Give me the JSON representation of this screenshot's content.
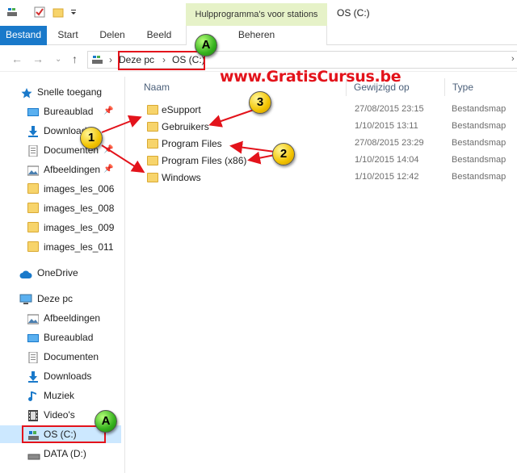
{
  "window": {
    "title": "OS (C:)",
    "context_tab": "Hulpprogramma's voor stations"
  },
  "ribbon": {
    "tabs": [
      "Bestand",
      "Start",
      "Delen",
      "Beeld",
      "Beheren"
    ]
  },
  "address": {
    "crumbs": [
      "Deze pc",
      "OS (C:)"
    ]
  },
  "watermark": "www.GratisCursus.be",
  "sidebar": {
    "quick_access": "Snelle toegang",
    "quick_items": [
      {
        "label": "Bureaublad",
        "icon": "desktop-icon"
      },
      {
        "label": "Downloads",
        "icon": "download-icon"
      },
      {
        "label": "Documenten",
        "icon": "document-icon"
      },
      {
        "label": "Afbeeldingen",
        "icon": "picture-icon"
      },
      {
        "label": "images_les_006",
        "icon": "folder-icon"
      },
      {
        "label": "images_les_008",
        "icon": "folder-icon"
      },
      {
        "label": "images_les_009",
        "icon": "folder-icon"
      },
      {
        "label": "images_les_011",
        "icon": "folder-icon"
      }
    ],
    "onedrive": "OneDrive",
    "this_pc": "Deze pc",
    "pc_items": [
      {
        "label": "Afbeeldingen",
        "icon": "picture-icon"
      },
      {
        "label": "Bureaublad",
        "icon": "desktop-icon"
      },
      {
        "label": "Documenten",
        "icon": "document-icon"
      },
      {
        "label": "Downloads",
        "icon": "download-icon"
      },
      {
        "label": "Muziek",
        "icon": "music-icon"
      },
      {
        "label": "Video's",
        "icon": "video-icon"
      },
      {
        "label": "OS (C:)",
        "icon": "drive-icon"
      },
      {
        "label": "DATA (D:)",
        "icon": "drive-icon"
      }
    ]
  },
  "columns": {
    "name": "Naam",
    "modified": "Gewijzigd op",
    "type": "Type"
  },
  "files": [
    {
      "name": "eSupport",
      "modified": "27/08/2015 23:15",
      "type": "Bestandsmap"
    },
    {
      "name": "Gebruikers",
      "modified": "1/10/2015 13:11",
      "type": "Bestandsmap"
    },
    {
      "name": "Program Files",
      "modified": "27/08/2015 23:29",
      "type": "Bestandsmap"
    },
    {
      "name": "Program Files (x86)",
      "modified": "1/10/2015 14:04",
      "type": "Bestandsmap"
    },
    {
      "name": "Windows",
      "modified": "1/10/2015 12:42",
      "type": "Bestandsmap"
    }
  ],
  "annotations": {
    "badge_1": "1",
    "badge_2": "2",
    "badge_3": "3",
    "badge_a": "A"
  },
  "colors": {
    "accent": "#1979ca",
    "annotation_red": "#e3131b",
    "badge_yellow": "#f2c300",
    "badge_green": "#35b21d"
  }
}
